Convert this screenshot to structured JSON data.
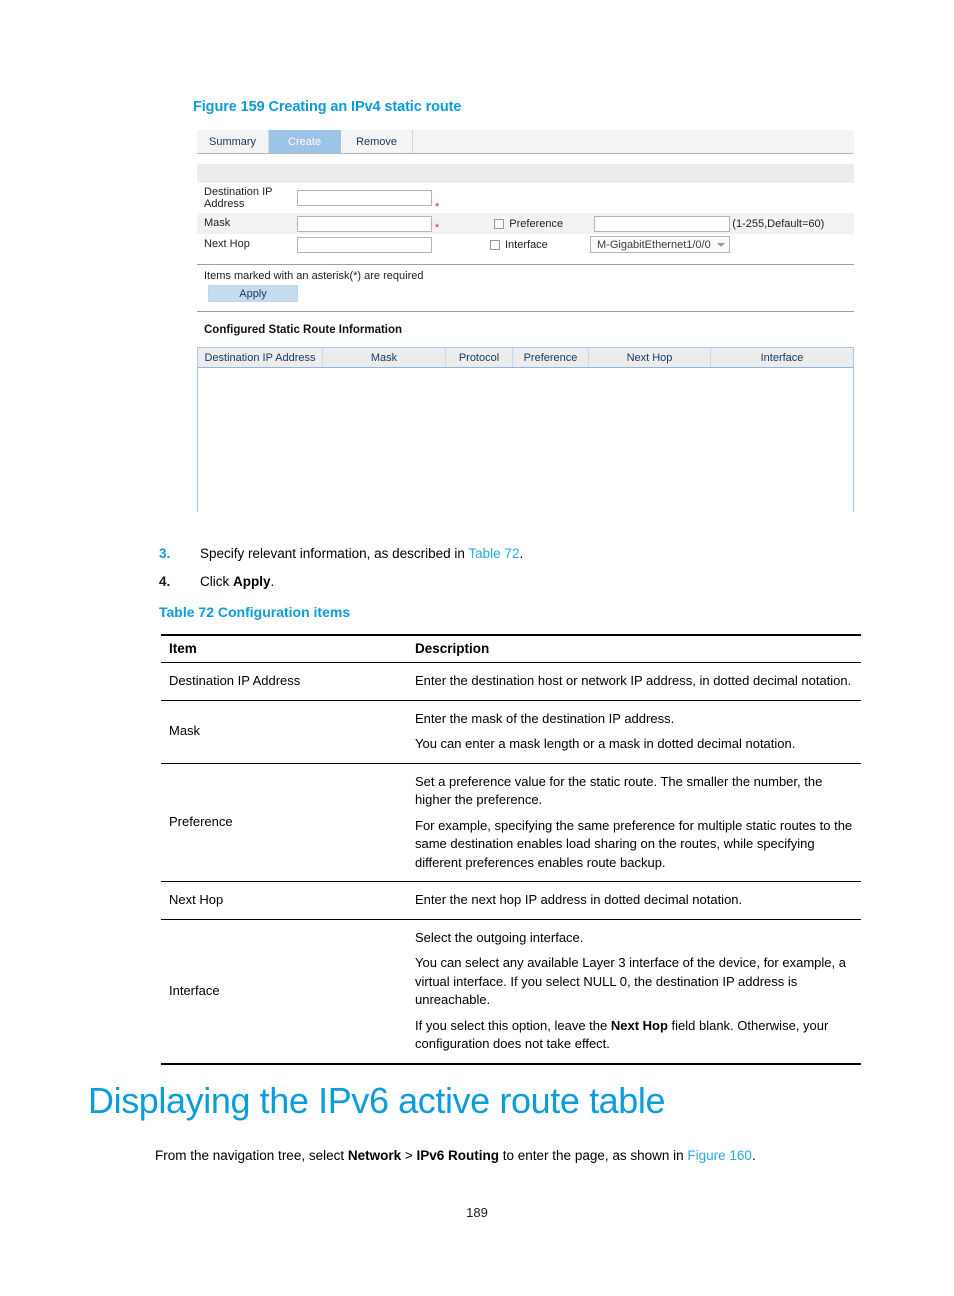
{
  "figure": {
    "caption": "Figure 159 Creating an IPv4 static route",
    "tabs": [
      {
        "label": "Summary",
        "active": false
      },
      {
        "label": "Create",
        "active": true
      },
      {
        "label": "Remove",
        "active": false
      }
    ],
    "form": {
      "fields": [
        {
          "label": "Destination IP Address",
          "value": "",
          "required_mark": "*"
        },
        {
          "label": "Mask",
          "value": "",
          "required_mark": "*"
        },
        {
          "label": "Next Hop",
          "value": "",
          "required_mark": ""
        }
      ],
      "preference": {
        "checkbox_label": "Preference",
        "checked": false,
        "value": "",
        "hint": "(1-255,Default=60)"
      },
      "interface": {
        "checkbox_label": "Interface",
        "checked": false,
        "selected": "M-GigabitEthernet1/0/0"
      },
      "required_note": "Items marked with an asterisk(*) are required",
      "apply_label": "Apply"
    },
    "results": {
      "section_title": "Configured Static Route Information",
      "columns": [
        "Destination IP Address",
        "Mask",
        "Protocol",
        "Preference",
        "Next Hop",
        "Interface"
      ],
      "rows": []
    }
  },
  "steps": [
    {
      "num": "3.",
      "text_before": "Specify relevant information, as described in ",
      "link": "Table 72",
      "text_after": "."
    },
    {
      "num": "4.",
      "text_before": "Click ",
      "bold": "Apply",
      "text_after": "."
    }
  ],
  "table72": {
    "caption": "Table 72 Configuration items",
    "headers": [
      "Item",
      "Description"
    ],
    "rows": [
      {
        "item": "Destination IP Address",
        "paragraphs": [
          "Enter the destination host or network IP address, in dotted decimal notation."
        ]
      },
      {
        "item": "Mask",
        "paragraphs": [
          "Enter the mask of the destination IP address.",
          "You can enter a mask length or a mask in dotted decimal notation."
        ]
      },
      {
        "item": "Preference",
        "paragraphs": [
          "Set a preference value for the static route. The smaller the number, the higher the preference.",
          "For example, specifying the same preference for multiple static routes to the same destination enables load sharing on the routes, while specifying different preferences enables route backup."
        ]
      },
      {
        "item": "Next Hop",
        "paragraphs": [
          "Enter the next hop IP address in dotted decimal notation."
        ]
      },
      {
        "item": "Interface",
        "paragraphs": [
          "Select the outgoing interface.",
          "You can select any available Layer 3 interface of the device, for example, a virtual interface. If you select NULL 0, the destination IP address is unreachable."
        ],
        "last_paragraph": {
          "before": "If you select this option, leave the ",
          "bold": "Next Hop",
          "after": " field blank. Otherwise, your configuration does not take effect."
        }
      }
    ]
  },
  "section": {
    "heading": "Displaying the IPv6 active route table",
    "paragraph": {
      "before": "From the navigation tree, select ",
      "bold1": "Network",
      "mid": " > ",
      "bold2": "IPv6 Routing",
      "after": " to enter the page, as shown in ",
      "link": "Figure 160",
      "end": "."
    }
  },
  "footer": {
    "page_number": "189"
  },
  "colors": {
    "heading_blue": "#0b9dd9",
    "link_blue": "#29a9e1",
    "tab_active_bg": "#9dc3e6",
    "apply_bg": "#c6dbf0",
    "required_red": "#d52b1e"
  }
}
